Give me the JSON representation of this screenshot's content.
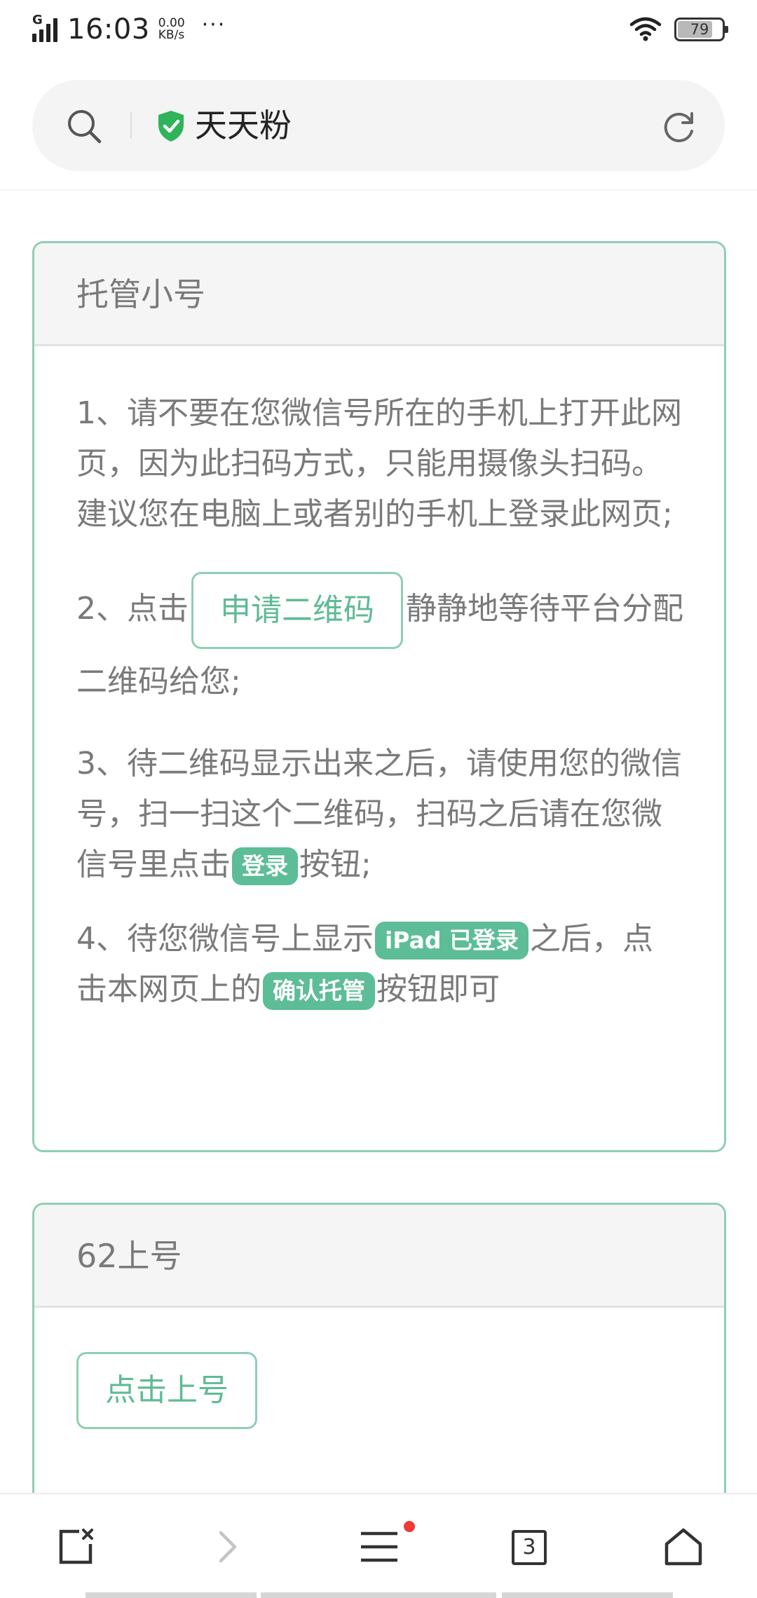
{
  "status_bar": {
    "network": "G",
    "time": "16:03",
    "speed_value": "0.00",
    "speed_unit": "KB/s",
    "more": "···",
    "battery": "79",
    "battery_fraction": 0.79
  },
  "address_bar": {
    "site_title": "天天粉",
    "icons": [
      "search-icon",
      "shield-check-icon",
      "refresh-icon"
    ]
  },
  "panel_hosting": {
    "title": "托管小号",
    "p1": "1、请不要在您微信号所在的手机上打开此网页，因为此扫码方式，只能用摄像头扫码。建议您在电脑上或者别的手机上登录此网页;",
    "p2_prefix": "2、点击",
    "p2_button": "申请二维码",
    "p2_suffix": "静静地等待平台分配二维码给您;",
    "p3_prefix": "3、待二维码显示出来之后，请使用您的微信号，扫一扫这个二维码，扫码之后请在您微信号里点击",
    "p3_pill": "登录",
    "p3_suffix": "按钮;",
    "p4_prefix": "4、待您微信号上显示",
    "p4_pill1": "iPad 已登录",
    "p4_middle": "之后，点击本网页上的",
    "p4_pill2": "确认托管",
    "p4_suffix": "按钮即可"
  },
  "panel_online": {
    "title": "62上号",
    "button": "点击上号"
  },
  "toolbar": {
    "tab_count": "3",
    "icons": [
      "new-tab-icon",
      "forward-icon",
      "menu-icon",
      "tabs-icon",
      "home-icon"
    ],
    "menu_badge_color": "#ef3b36"
  },
  "colors": {
    "accent": "#5cbd96",
    "border": "#8fcfb3",
    "shield": "#2fb45a"
  }
}
